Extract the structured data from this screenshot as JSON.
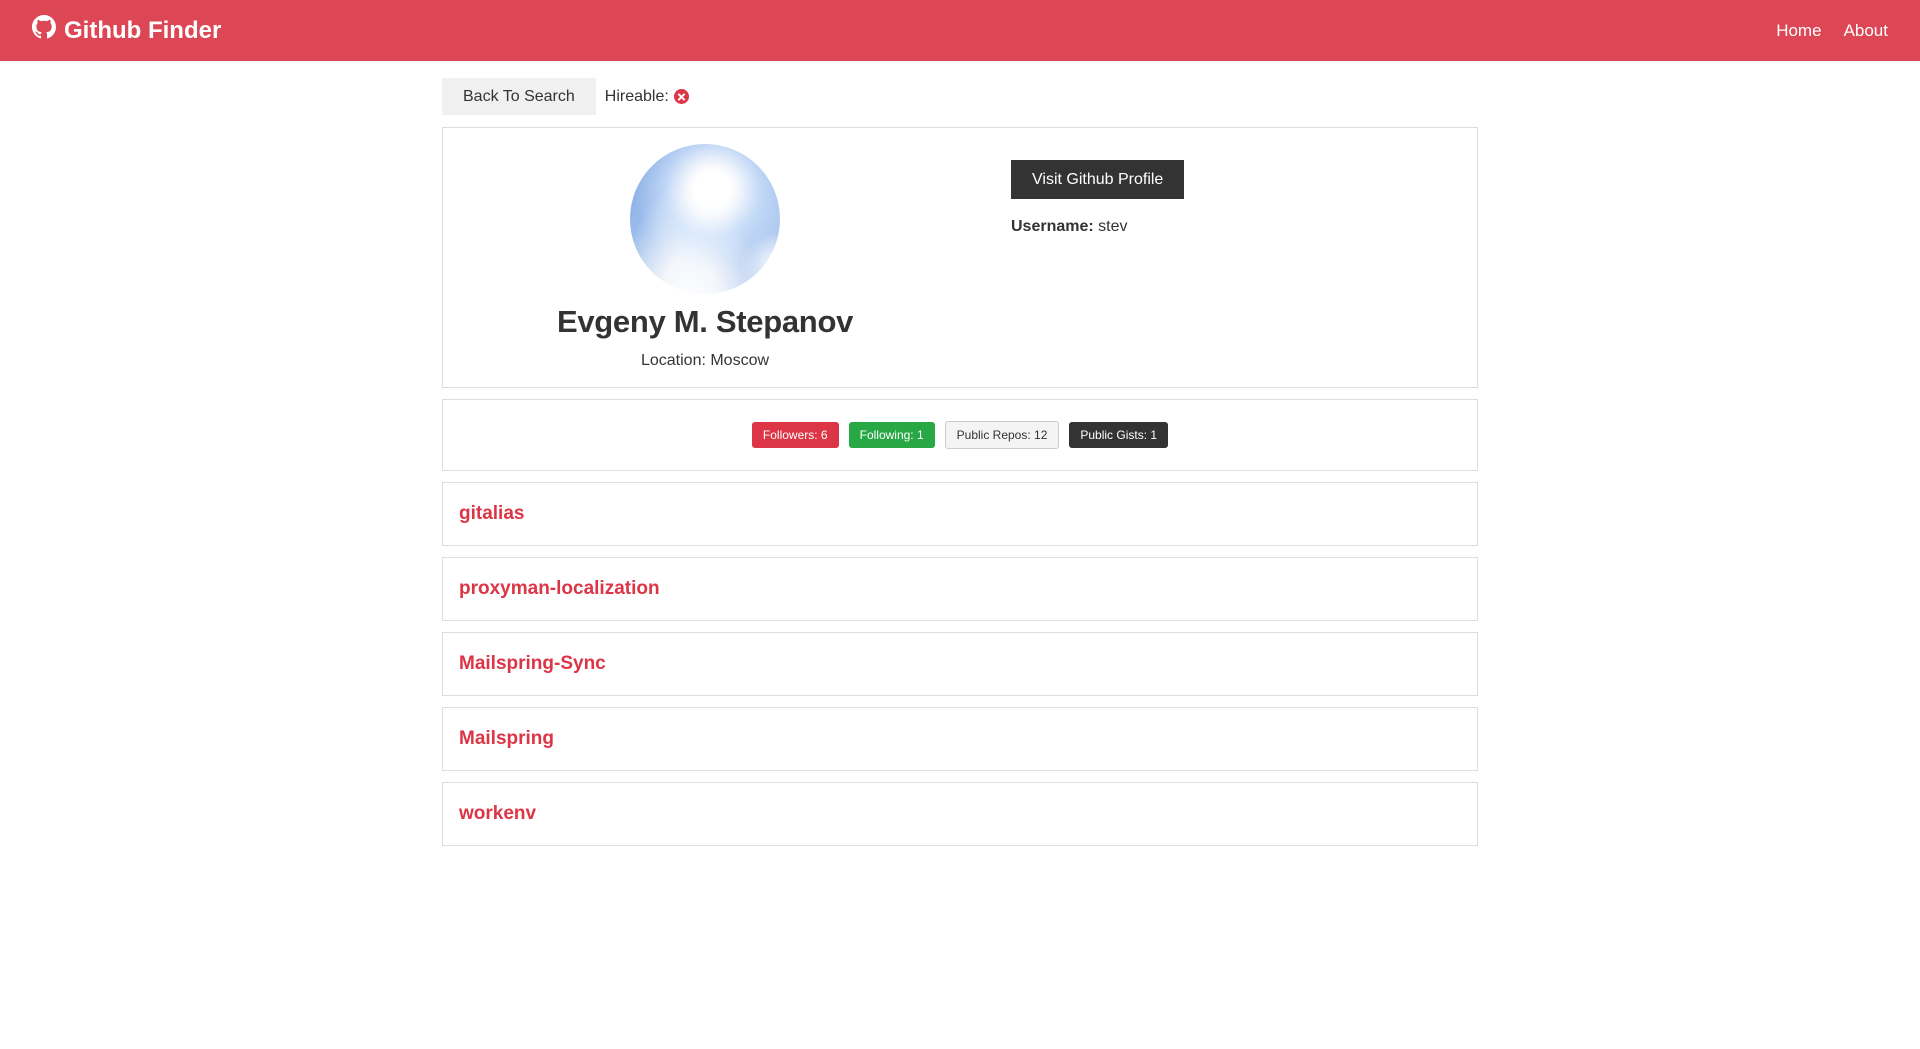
{
  "navbar": {
    "brand": "Github Finder",
    "links": [
      "Home",
      "About"
    ]
  },
  "topbar": {
    "back_label": "Back To Search",
    "hireable_label": "Hireable:"
  },
  "profile": {
    "name": "Evgeny M. Stepanov",
    "location_label": "Location: Moscow",
    "visit_label": "Visit Github Profile",
    "username_label": "Username:",
    "username_value": "stev"
  },
  "stats": {
    "followers": "Followers: 6",
    "following": "Following: 1",
    "public_repos": "Public Repos: 12",
    "public_gists": "Public Gists: 1"
  },
  "repos": [
    "gitalias",
    "proxyman-localization",
    "Mailspring-Sync",
    "Mailspring",
    "workenv"
  ],
  "colors": {
    "navbar": "#dc4655",
    "danger": "#dc3545",
    "success": "#28a745",
    "dark": "#333333"
  },
  "icons": {
    "brand": "github-icon",
    "hireable": "x-circle-icon",
    "avatar": "sky-sun-avatar"
  }
}
